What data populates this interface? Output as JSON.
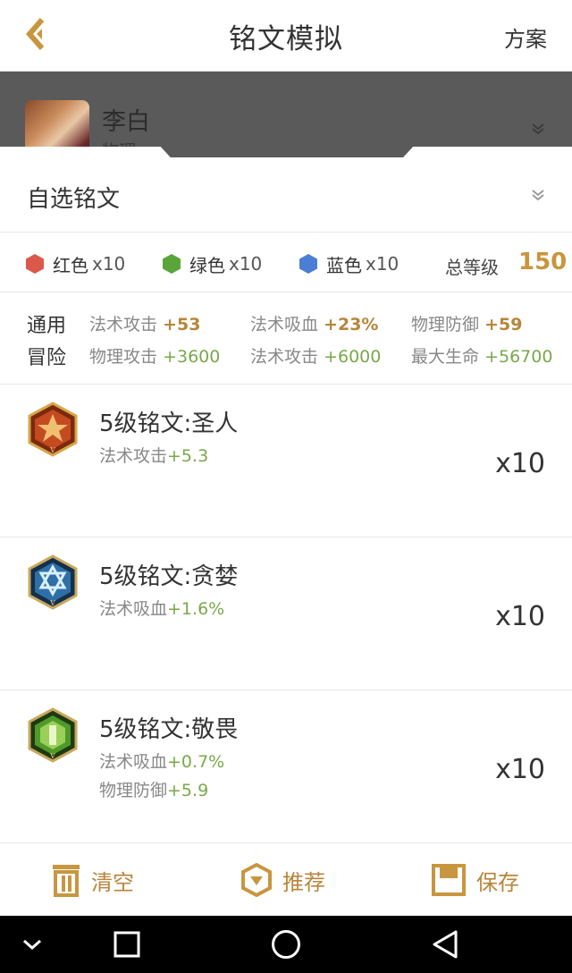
{
  "header": {
    "title": "铭文模拟",
    "plan_label": "方案"
  },
  "hero": {
    "name": "李白",
    "type": "物理"
  },
  "selector": {
    "label": "自选铭文"
  },
  "counts": [
    {
      "label": "红色",
      "count": "x10",
      "color": "#d95a4a"
    },
    {
      "label": "绿色",
      "count": "x10",
      "color": "#5aa53a"
    },
    {
      "label": "蓝色",
      "count": "x10",
      "color": "#4a7fd4"
    }
  ],
  "total": {
    "label": "总等级",
    "value": "150"
  },
  "attributes": {
    "general": {
      "label": "通用",
      "items": [
        {
          "name": "法术攻击",
          "value": "+53"
        },
        {
          "name": "法术吸血",
          "value": "+23%"
        },
        {
          "name": "物理防御",
          "value": "+59"
        }
      ]
    },
    "adventure": {
      "label": "冒险",
      "items": [
        {
          "name": "物理攻击",
          "value": "+3600"
        },
        {
          "name": "法术攻击",
          "value": "+6000"
        },
        {
          "name": "最大生命",
          "value": "+56700"
        }
      ]
    }
  },
  "runes": [
    {
      "name": "5级铭文:圣人",
      "stats": [
        {
          "name": "法术攻击",
          "value": "+5.3"
        }
      ],
      "count": "x10",
      "color": "red"
    },
    {
      "name": "5级铭文:贪婪",
      "stats": [
        {
          "name": "法术吸血",
          "value": "+1.6%"
        }
      ],
      "count": "x10",
      "color": "blue"
    },
    {
      "name": "5级铭文:敬畏",
      "stats": [
        {
          "name": "法术吸血",
          "value": "+0.7%"
        },
        {
          "name": "物理防御",
          "value": "+5.9"
        }
      ],
      "count": "x10",
      "color": "green"
    }
  ],
  "bottom_actions": {
    "clear": "清空",
    "recommend": "推荐",
    "save": "保存"
  },
  "colors": {
    "accent": "#c8963e",
    "green_value": "#7aa84a"
  }
}
